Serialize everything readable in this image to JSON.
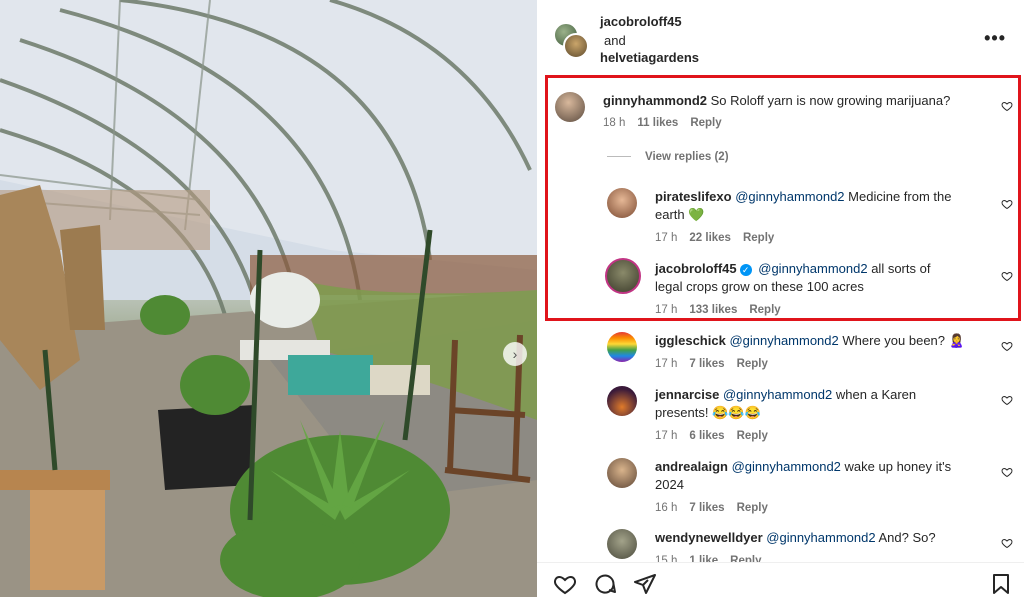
{
  "header": {
    "user1": "jacobroloff45",
    "and_word": "and",
    "user2": "helvetiagardens",
    "more_label": "•••"
  },
  "comments": [
    {
      "user": "ginnyhammond2",
      "text": "So Roloff yarn is now growing marijuana?",
      "time": "18 h",
      "likes": "11 likes",
      "reply": "Reply"
    },
    {
      "user": "pirateslifexo",
      "mention": "@ginnyhammond2",
      "text": "Medicine from the",
      "text2": "earth 💚",
      "time": "17 h",
      "likes": "22 likes",
      "reply": "Reply"
    },
    {
      "user": "jacobroloff45",
      "mention": "@ginnyhammond2",
      "text": "all sorts of",
      "text2": "legal crops grow on these 100 acres",
      "time": "17 h",
      "likes": "133 likes",
      "reply": "Reply"
    },
    {
      "user": "iggleschick",
      "mention": "@ginnyhammond2",
      "text": "Where you been? 🙎‍♀️",
      "time": "17 h",
      "likes": "7 likes",
      "reply": "Reply"
    },
    {
      "user": "jennarcise",
      "mention": "@ginnyhammond2",
      "text": "when a Karen",
      "text2": "presents! 😂😂😂",
      "time": "17 h",
      "likes": "6 likes",
      "reply": "Reply"
    },
    {
      "user": "andrealaign",
      "mention": "@ginnyhammond2",
      "text": "wake up honey it's",
      "text2": "2024",
      "time": "16 h",
      "likes": "7 likes",
      "reply": "Reply"
    },
    {
      "user": "wendynewelldyer",
      "mention": "@ginnyhammond2",
      "text": "And? So?",
      "time": "15 h",
      "likes": "1 like",
      "reply": "Reply"
    }
  ],
  "view_replies": "View replies (2)",
  "icons": {
    "heart": "heart-icon",
    "comment": "comment-icon",
    "share": "share-icon",
    "save": "bookmark-icon",
    "verified": "verified-badge-icon",
    "next": "chevron-right-icon"
  },
  "colors": {
    "highlight": "#e0141b",
    "mention": "#00376b",
    "meta": "#737373",
    "verified": "#0095f6"
  }
}
